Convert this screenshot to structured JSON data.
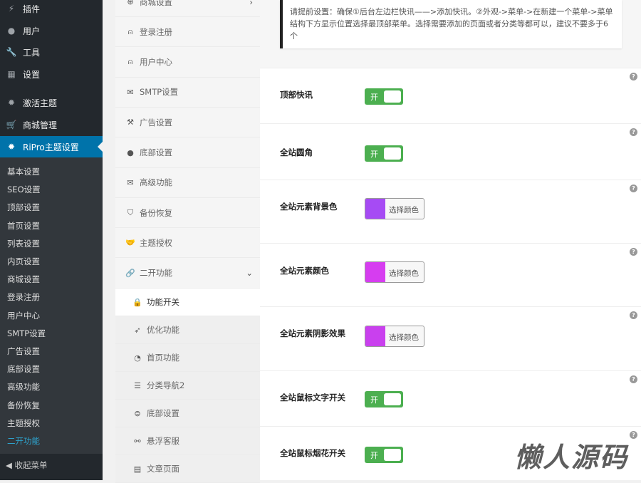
{
  "wp_menu": [
    {
      "label": "插件",
      "icon": "plugin-icon"
    },
    {
      "label": "用户",
      "icon": "user-icon"
    },
    {
      "label": "工具",
      "icon": "wrench-icon"
    },
    {
      "label": "设置",
      "icon": "settings-icon"
    },
    {
      "label": "激活主题",
      "icon": "gear-icon"
    },
    {
      "label": "商城管理",
      "icon": "cart-icon"
    },
    {
      "label": "RiPro主题设置",
      "icon": "gear-icon",
      "active": true
    }
  ],
  "wp_submenu": [
    "基本设置",
    "SEO设置",
    "顶部设置",
    "首页设置",
    "列表设置",
    "内页设置",
    "商城设置",
    "登录注册",
    "用户中心",
    "SMTP设置",
    "广告设置",
    "底部设置",
    "高级功能",
    "备份恢复",
    "主题授权",
    "二开功能"
  ],
  "collapse_label": "收起菜单",
  "panel_menu": [
    "商城设置",
    "登录注册",
    "用户中心",
    "SMTP设置",
    "广告设置",
    "底部设置",
    "高级功能",
    "备份恢复",
    "主题授权",
    "二开功能"
  ],
  "panel_sub": [
    "功能开关",
    "优化功能",
    "首页功能",
    "分类导航2",
    "底部设置",
    "悬浮客服",
    "文章页面"
  ],
  "notice": "请提前设置：确保①后台左边栏快讯——>添加快讯。②外观->菜单->在新建一个菜单->菜单结构下方显示位置选择最顶部菜单。选择需要添加的页面或者分类等都可以，建议不要多于6个",
  "settings": [
    {
      "label": "顶部快讯",
      "type": "toggle",
      "value": "开"
    },
    {
      "label": "全站圆角",
      "type": "toggle",
      "value": "开"
    },
    {
      "label": "全站元素背景色",
      "type": "color",
      "button": "选择颜色",
      "color": "#a64bf4"
    },
    {
      "label": "全站元素颜色",
      "type": "color",
      "button": "选择颜色",
      "color": "#d63df0"
    },
    {
      "label": "全站元素阴影效果",
      "type": "color",
      "button": "选择颜色",
      "color": "#c940ee"
    },
    {
      "label": "全站鼠标文字开关",
      "type": "toggle",
      "value": "开"
    },
    {
      "label": "全站鼠标烟花开关",
      "type": "toggle",
      "value": "开"
    }
  ],
  "help_label": "?",
  "watermark": "懒人源码"
}
